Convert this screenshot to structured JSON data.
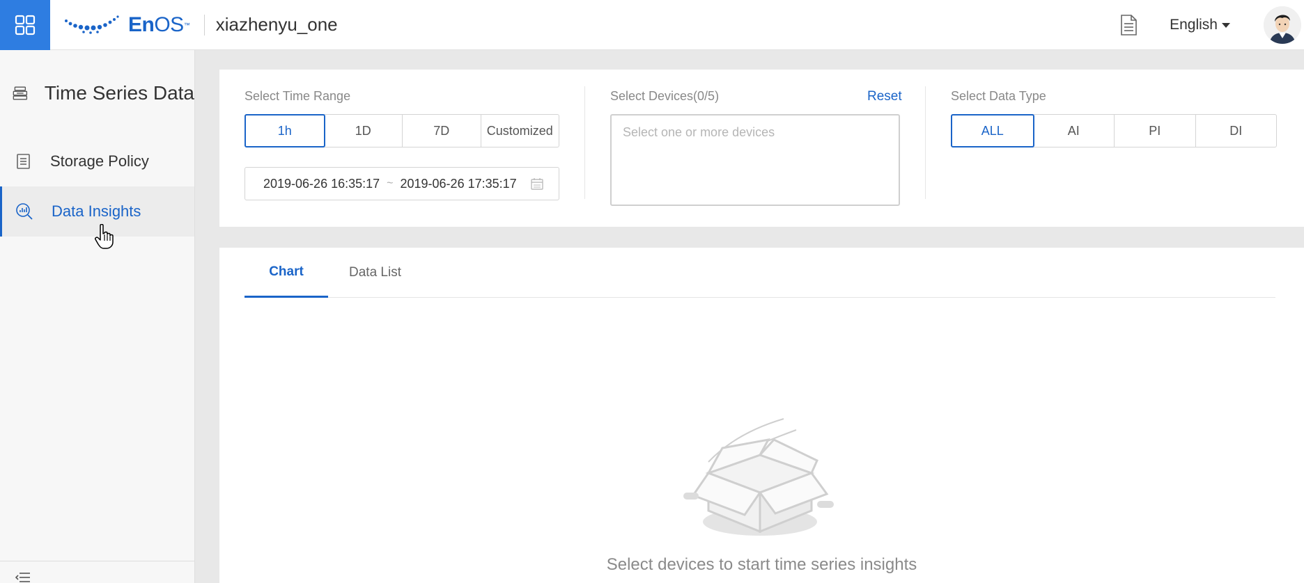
{
  "header": {
    "logo_text_en": "En",
    "logo_text_os": "OS",
    "logo_tm": "™",
    "org_name": "xiazhenyu_one",
    "language": "English",
    "app_grid_icon": "grid-icon",
    "doc_icon": "document-icon",
    "brand_color": "#2e7de1"
  },
  "sidebar": {
    "title": "Time Series Data",
    "items": [
      {
        "label": "Storage Policy",
        "icon": "storage-policy-icon",
        "active": false
      },
      {
        "label": "Data Insights",
        "icon": "data-insights-icon",
        "active": true
      }
    ],
    "collapse_icon": "collapse-icon"
  },
  "filters": {
    "time_range": {
      "label": "Select Time Range",
      "options": [
        "1h",
        "1D",
        "7D",
        "Customized"
      ],
      "selected": "1h",
      "start": "2019-06-26 16:35:17",
      "separator": "~",
      "end": "2019-06-26 17:35:17"
    },
    "devices": {
      "label": "Select Devices(0/5)",
      "reset_label": "Reset",
      "placeholder": "Select one or more devices"
    },
    "data_type": {
      "label": "Select Data Type",
      "options": [
        "ALL",
        "AI",
        "PI",
        "DI"
      ],
      "selected": "ALL"
    }
  },
  "content": {
    "tabs": [
      "Chart",
      "Data List"
    ],
    "active_tab": "Chart",
    "empty_message": "Select devices to start time series insights"
  },
  "colors": {
    "accent": "#1a64c8",
    "panel": "#ffffff",
    "background": "#e8e8e8"
  }
}
